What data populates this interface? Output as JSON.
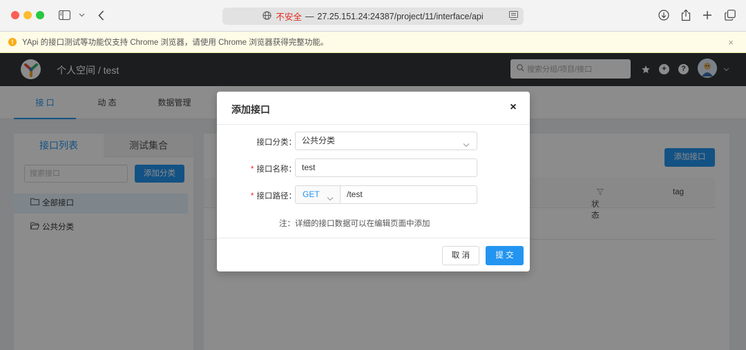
{
  "browser": {
    "url_insecure_label": "不安全",
    "url_separator": "—",
    "url": "27.25.151.24:24387/project/11/interface/api"
  },
  "warning": {
    "text": "YApi 的接口测试等功能仅支持 Chrome 浏览器，请使用 Chrome 浏览器获得完整功能。",
    "close": "×"
  },
  "header": {
    "breadcrumb": "个人空间 / test",
    "search_placeholder": "搜索分组/项目/接口"
  },
  "subnav": {
    "tabs": [
      {
        "label": "接 口",
        "active": true
      },
      {
        "label": "动 态",
        "active": false
      },
      {
        "label": "数据管理",
        "active": false
      }
    ]
  },
  "left_panel": {
    "tabs": [
      {
        "label": "接口列表",
        "active": true
      },
      {
        "label": "测试集合",
        "active": false
      }
    ],
    "search_placeholder": "搜索接口",
    "add_category_label": "添加分类",
    "tree": [
      {
        "label": "全部接口",
        "selected": true
      },
      {
        "label": "公共分类",
        "selected": false
      }
    ]
  },
  "right_panel": {
    "add_interface_label": "添加接口",
    "columns": [
      "状态",
      "tag"
    ]
  },
  "modal": {
    "title": "添加接口",
    "close": "×",
    "fields": {
      "category_label": "接口分类：",
      "category_value": "公共分类",
      "name_required": "*",
      "name_label": "接口名称：",
      "name_value": "test",
      "path_required": "*",
      "path_label": "接口路径：",
      "method_value": "GET",
      "path_value": "/test"
    },
    "note": "注：详细的接口数据可以在编辑页面中添加",
    "cancel_label": "取 消",
    "submit_label": "提 交"
  },
  "colors": {
    "primary": "#2395f1",
    "header_bg": "#32363a",
    "required": "#f5222d",
    "insecure": "#e02b20"
  }
}
